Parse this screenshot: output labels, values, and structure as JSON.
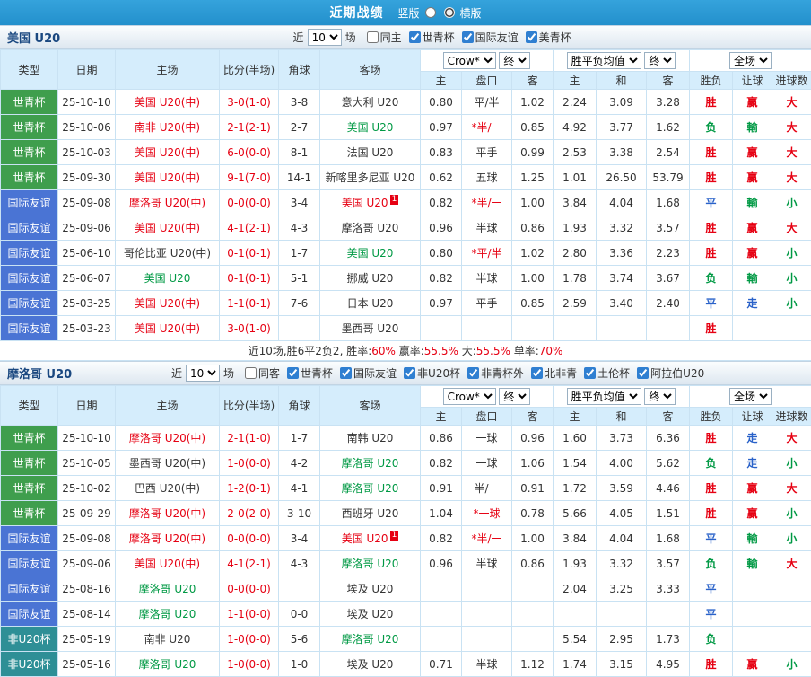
{
  "topbar": {
    "title": "近期战绩",
    "radio_vertical": "竖版",
    "radio_horizontal": "横版",
    "selected": "横版"
  },
  "controls": {
    "near_label": "近",
    "near_value": "10",
    "games_label": "场",
    "bookmaker": "Crow*",
    "final_label": "终",
    "avg_label": "胜平负均值",
    "scope_label": "全场"
  },
  "columns": {
    "type": "类型",
    "date": "日期",
    "home": "主场",
    "score": "比分(半场)",
    "corner": "角球",
    "away": "客场",
    "odds_home": "主",
    "odds_line": "盘口",
    "odds_away": "客",
    "avg_home": "主",
    "avg_draw": "和",
    "avg_away": "客",
    "result_wdl": "胜负",
    "result_handicap": "让球",
    "result_goals": "进球数"
  },
  "comp_colors": {
    "世青杯": "#3f9e4d",
    "国际友谊": "#4a74d4",
    "非U20杯": "#2e8f96"
  },
  "text_colors": {
    "red": "#e60012",
    "green": "#009944",
    "blue": "#2a62c9",
    "black": "#333333"
  },
  "sections": [
    {
      "team": "美国 U20",
      "filters": [
        {
          "label": "同主",
          "checked": false
        },
        {
          "label": "世青杯",
          "checked": true
        },
        {
          "label": "国际友谊",
          "checked": true
        },
        {
          "label": "美青杯",
          "checked": true
        }
      ],
      "rows": [
        {
          "comp": "世青杯",
          "date": "25-10-10",
          "home": "美国 U20(中)",
          "home_color": "red",
          "score": "3-0(1-0)",
          "corner": "3-8",
          "away": "意大利 U20",
          "away_color": "black",
          "away_badge": "",
          "o1": "0.80",
          "line": "平/半",
          "line_color": "black",
          "o2": "1.02",
          "a1": "2.24",
          "a2": "3.09",
          "a3": "3.28",
          "res": [
            "胜",
            "赢",
            "大"
          ],
          "resc": [
            "red",
            "red",
            "red"
          ]
        },
        {
          "comp": "世青杯",
          "date": "25-10-06",
          "home": "南非 U20(中)",
          "home_color": "red",
          "score": "2-1(2-1)",
          "corner": "2-7",
          "away": "美国 U20",
          "away_color": "green",
          "away_badge": "",
          "o1": "0.97",
          "line": "*半/一",
          "line_color": "red",
          "o2": "0.85",
          "a1": "4.92",
          "a2": "3.77",
          "a3": "1.62",
          "res": [
            "负",
            "輸",
            "大"
          ],
          "resc": [
            "green",
            "green",
            "red"
          ]
        },
        {
          "comp": "世青杯",
          "date": "25-10-03",
          "home": "美国 U20(中)",
          "home_color": "red",
          "score": "6-0(0-0)",
          "corner": "8-1",
          "away": "法国 U20",
          "away_color": "black",
          "away_badge": "",
          "o1": "0.83",
          "line": "平手",
          "line_color": "black",
          "o2": "0.99",
          "a1": "2.53",
          "a2": "3.38",
          "a3": "2.54",
          "res": [
            "胜",
            "赢",
            "大"
          ],
          "resc": [
            "red",
            "red",
            "red"
          ]
        },
        {
          "comp": "世青杯",
          "date": "25-09-30",
          "home": "美国 U20(中)",
          "home_color": "red",
          "score": "9-1(7-0)",
          "corner": "14-1",
          "away": "新喀里多尼亚 U20",
          "away_color": "black",
          "away_badge": "",
          "o1": "0.62",
          "line": "五球",
          "line_color": "black",
          "o2": "1.25",
          "a1": "1.01",
          "a2": "26.50",
          "a3": "53.79",
          "res": [
            "胜",
            "赢",
            "大"
          ],
          "resc": [
            "red",
            "red",
            "red"
          ]
        },
        {
          "comp": "国际友谊",
          "date": "25-09-08",
          "home": "摩洛哥 U20(中)",
          "home_color": "red",
          "score": "0-0(0-0)",
          "corner": "3-4",
          "away": "美国 U20",
          "away_color": "red",
          "away_badge": "1",
          "o1": "0.82",
          "line": "*半/一",
          "line_color": "red",
          "o2": "1.00",
          "a1": "3.84",
          "a2": "4.04",
          "a3": "1.68",
          "res": [
            "平",
            "輸",
            "小"
          ],
          "resc": [
            "blue",
            "green",
            "green"
          ]
        },
        {
          "comp": "国际友谊",
          "date": "25-09-06",
          "home": "美国 U20(中)",
          "home_color": "red",
          "score": "4-1(2-1)",
          "corner": "4-3",
          "away": "摩洛哥 U20",
          "away_color": "black",
          "away_badge": "",
          "o1": "0.96",
          "line": "半球",
          "line_color": "black",
          "o2": "0.86",
          "a1": "1.93",
          "a2": "3.32",
          "a3": "3.57",
          "res": [
            "胜",
            "赢",
            "大"
          ],
          "resc": [
            "red",
            "red",
            "red"
          ]
        },
        {
          "comp": "国际友谊",
          "date": "25-06-10",
          "home": "哥伦比亚 U20(中)",
          "home_color": "black",
          "score": "0-1(0-1)",
          "corner": "1-7",
          "away": "美国 U20",
          "away_color": "green",
          "away_badge": "",
          "o1": "0.80",
          "line": "*平/半",
          "line_color": "red",
          "o2": "1.02",
          "a1": "2.80",
          "a2": "3.36",
          "a3": "2.23",
          "res": [
            "胜",
            "赢",
            "小"
          ],
          "resc": [
            "red",
            "red",
            "green"
          ]
        },
        {
          "comp": "国际友谊",
          "date": "25-06-07",
          "home": "美国 U20",
          "home_color": "green",
          "score": "0-1(0-1)",
          "corner": "5-1",
          "away": "挪威 U20",
          "away_color": "black",
          "away_badge": "",
          "o1": "0.82",
          "line": "半球",
          "line_color": "black",
          "o2": "1.00",
          "a1": "1.78",
          "a2": "3.74",
          "a3": "3.67",
          "res": [
            "负",
            "輸",
            "小"
          ],
          "resc": [
            "green",
            "green",
            "green"
          ]
        },
        {
          "comp": "国际友谊",
          "date": "25-03-25",
          "home": "美国 U20(中)",
          "home_color": "red",
          "score": "1-1(0-1)",
          "corner": "7-6",
          "away": "日本 U20",
          "away_color": "black",
          "away_badge": "",
          "o1": "0.97",
          "line": "平手",
          "line_color": "black",
          "o2": "0.85",
          "a1": "2.59",
          "a2": "3.40",
          "a3": "2.40",
          "res": [
            "平",
            "走",
            "小"
          ],
          "resc": [
            "blue",
            "blue",
            "green"
          ]
        },
        {
          "comp": "国际友谊",
          "date": "25-03-23",
          "home": "美国 U20(中)",
          "home_color": "red",
          "score": "3-0(1-0)",
          "corner": "",
          "away": "墨西哥 U20",
          "away_color": "black",
          "away_badge": "",
          "o1": "",
          "line": "",
          "line_color": "black",
          "o2": "",
          "a1": "",
          "a2": "",
          "a3": "",
          "res": [
            "胜",
            "",
            ""
          ],
          "resc": [
            "red",
            "black",
            "black"
          ]
        }
      ],
      "summary": {
        "parts": [
          {
            "t": "近10场,胜6平2负2, 胜率:",
            "c": "black"
          },
          {
            "t": "60%",
            "c": "red"
          },
          {
            "t": " 赢率:",
            "c": "black"
          },
          {
            "t": "55.5%",
            "c": "red"
          },
          {
            "t": " 大:",
            "c": "black"
          },
          {
            "t": "55.5%",
            "c": "red"
          },
          {
            "t": " 单率:",
            "c": "black"
          },
          {
            "t": "70%",
            "c": "red"
          }
        ]
      }
    },
    {
      "team": "摩洛哥 U20",
      "filters": [
        {
          "label": "同客",
          "checked": false
        },
        {
          "label": "世青杯",
          "checked": true
        },
        {
          "label": "国际友谊",
          "checked": true
        },
        {
          "label": "非U20杯",
          "checked": true
        },
        {
          "label": "非青杯外",
          "checked": true
        },
        {
          "label": "北非青",
          "checked": true
        },
        {
          "label": "土伦杯",
          "checked": true
        },
        {
          "label": "阿拉伯U20",
          "checked": true
        }
      ],
      "rows": [
        {
          "comp": "世青杯",
          "date": "25-10-10",
          "home": "摩洛哥 U20(中)",
          "home_color": "red",
          "score": "2-1(1-0)",
          "corner": "1-7",
          "away": "南韩 U20",
          "away_color": "black",
          "away_badge": "",
          "o1": "0.86",
          "line": "一球",
          "line_color": "black",
          "o2": "0.96",
          "a1": "1.60",
          "a2": "3.73",
          "a3": "6.36",
          "res": [
            "胜",
            "走",
            "大"
          ],
          "resc": [
            "red",
            "blue",
            "red"
          ]
        },
        {
          "comp": "世青杯",
          "date": "25-10-05",
          "home": "墨西哥 U20(中)",
          "home_color": "black",
          "score": "1-0(0-0)",
          "corner": "4-2",
          "away": "摩洛哥 U20",
          "away_color": "green",
          "away_badge": "",
          "o1": "0.82",
          "line": "一球",
          "line_color": "black",
          "o2": "1.06",
          "a1": "1.54",
          "a2": "4.00",
          "a3": "5.62",
          "res": [
            "负",
            "走",
            "小"
          ],
          "resc": [
            "green",
            "blue",
            "green"
          ]
        },
        {
          "comp": "世青杯",
          "date": "25-10-02",
          "home": "巴西 U20(中)",
          "home_color": "black",
          "score": "1-2(0-1)",
          "corner": "4-1",
          "away": "摩洛哥 U20",
          "away_color": "green",
          "away_badge": "",
          "o1": "0.91",
          "line": "半/一",
          "line_color": "black",
          "o2": "0.91",
          "a1": "1.72",
          "a2": "3.59",
          "a3": "4.46",
          "res": [
            "胜",
            "赢",
            "大"
          ],
          "resc": [
            "red",
            "red",
            "red"
          ]
        },
        {
          "comp": "世青杯",
          "date": "25-09-29",
          "home": "摩洛哥 U20(中)",
          "home_color": "red",
          "score": "2-0(2-0)",
          "corner": "3-10",
          "away": "西班牙 U20",
          "away_color": "black",
          "away_badge": "",
          "o1": "1.04",
          "line": "*一球",
          "line_color": "red",
          "o2": "0.78",
          "a1": "5.66",
          "a2": "4.05",
          "a3": "1.51",
          "res": [
            "胜",
            "赢",
            "小"
          ],
          "resc": [
            "red",
            "red",
            "green"
          ]
        },
        {
          "comp": "国际友谊",
          "date": "25-09-08",
          "home": "摩洛哥 U20(中)",
          "home_color": "red",
          "score": "0-0(0-0)",
          "corner": "3-4",
          "away": "美国 U20",
          "away_color": "red",
          "away_badge": "1",
          "o1": "0.82",
          "line": "*半/一",
          "line_color": "red",
          "o2": "1.00",
          "a1": "3.84",
          "a2": "4.04",
          "a3": "1.68",
          "res": [
            "平",
            "輸",
            "小"
          ],
          "resc": [
            "blue",
            "green",
            "green"
          ]
        },
        {
          "comp": "国际友谊",
          "date": "25-09-06",
          "home": "美国 U20(中)",
          "home_color": "red",
          "score": "4-1(2-1)",
          "corner": "4-3",
          "away": "摩洛哥 U20",
          "away_color": "green",
          "away_badge": "",
          "o1": "0.96",
          "line": "半球",
          "line_color": "black",
          "o2": "0.86",
          "a1": "1.93",
          "a2": "3.32",
          "a3": "3.57",
          "res": [
            "负",
            "輸",
            "大"
          ],
          "resc": [
            "green",
            "green",
            "red"
          ]
        },
        {
          "comp": "国际友谊",
          "date": "25-08-16",
          "home": "摩洛哥 U20",
          "home_color": "green",
          "score": "0-0(0-0)",
          "corner": "",
          "away": "埃及 U20",
          "away_color": "black",
          "away_badge": "",
          "o1": "",
          "line": "",
          "line_color": "black",
          "o2": "",
          "a1": "2.04",
          "a2": "3.25",
          "a3": "3.33",
          "res": [
            "平",
            "",
            ""
          ],
          "resc": [
            "blue",
            "black",
            "black"
          ]
        },
        {
          "comp": "国际友谊",
          "date": "25-08-14",
          "home": "摩洛哥 U20",
          "home_color": "green",
          "score": "1-1(0-0)",
          "corner": "0-0",
          "away": "埃及 U20",
          "away_color": "black",
          "away_badge": "",
          "o1": "",
          "line": "",
          "line_color": "black",
          "o2": "",
          "a1": "",
          "a2": "",
          "a3": "",
          "res": [
            "平",
            "",
            ""
          ],
          "resc": [
            "blue",
            "black",
            "black"
          ]
        },
        {
          "comp": "非U20杯",
          "date": "25-05-19",
          "home": "南非 U20",
          "home_color": "black",
          "score": "1-0(0-0)",
          "corner": "5-6",
          "away": "摩洛哥 U20",
          "away_color": "green",
          "away_badge": "",
          "o1": "",
          "line": "",
          "line_color": "black",
          "o2": "",
          "a1": "5.54",
          "a2": "2.95",
          "a3": "1.73",
          "res": [
            "负",
            "",
            ""
          ],
          "resc": [
            "green",
            "black",
            "black"
          ]
        },
        {
          "comp": "非U20杯",
          "date": "25-05-16",
          "home": "摩洛哥 U20",
          "home_color": "green",
          "score": "1-0(0-0)",
          "corner": "1-0",
          "away": "埃及 U20",
          "away_color": "black",
          "away_badge": "",
          "o1": "0.71",
          "line": "半球",
          "line_color": "black",
          "o2": "1.12",
          "a1": "1.74",
          "a2": "3.15",
          "a3": "4.95",
          "res": [
            "胜",
            "赢",
            "小"
          ],
          "resc": [
            "red",
            "red",
            "green"
          ]
        }
      ],
      "summary": null
    }
  ]
}
